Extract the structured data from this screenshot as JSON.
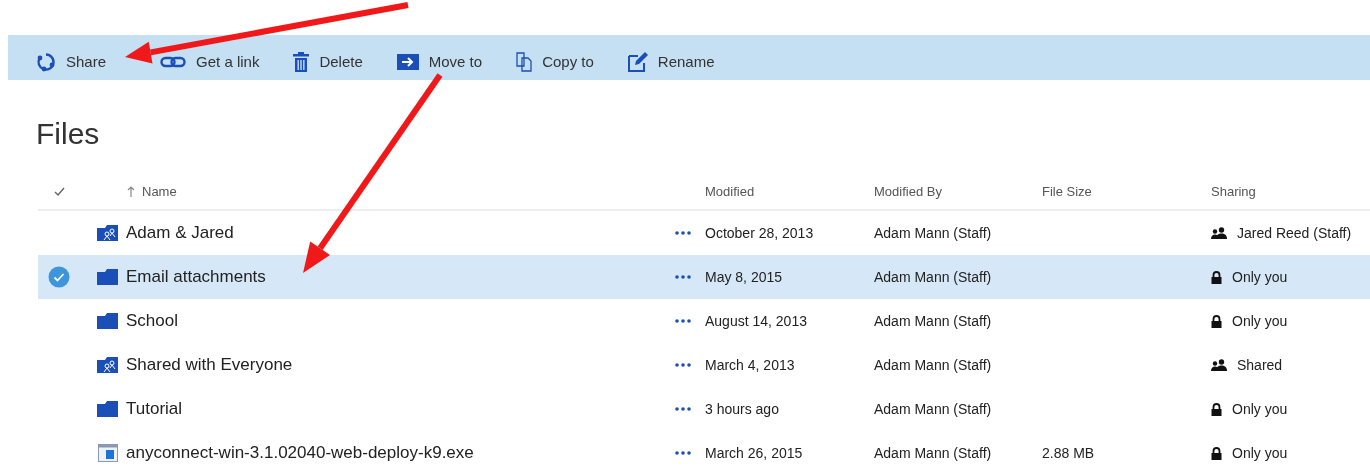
{
  "toolbar": [
    {
      "kind": "share",
      "label": "Share"
    },
    {
      "kind": "link",
      "label": "Get a link"
    },
    {
      "kind": "delete",
      "label": "Delete"
    },
    {
      "kind": "move",
      "label": "Move to"
    },
    {
      "kind": "copy",
      "label": "Copy to"
    },
    {
      "kind": "rename",
      "label": "Rename"
    }
  ],
  "title": "Files",
  "table": {
    "columns": [
      "Name",
      "Modified",
      "Modified By",
      "File Size",
      "Sharing"
    ],
    "rows": [
      {
        "kind": "shared-folder",
        "name": "Adam & Jared",
        "selected": false,
        "modified": "October 28, 2013",
        "modified_by": "Adam Mann (Staff)",
        "sharing": {
          "kind": "people",
          "label": "Jared Reed (Staff)"
        }
      },
      {
        "kind": "folder",
        "name": "Email attachments",
        "selected": true,
        "modified": "May 8, 2015",
        "modified_by": "Adam Mann (Staff)",
        "sharing": {
          "kind": "lock",
          "label": "Only you"
        }
      },
      {
        "kind": "folder",
        "name": "School",
        "selected": false,
        "modified": "August 14, 2013",
        "modified_by": "Adam Mann (Staff)",
        "sharing": {
          "kind": "lock",
          "label": "Only you"
        }
      },
      {
        "kind": "shared-folder",
        "name": "Shared with Everyone",
        "selected": false,
        "modified": "March 4, 2013",
        "modified_by": "Adam Mann (Staff)",
        "sharing": {
          "kind": "people",
          "label": "Shared"
        }
      },
      {
        "kind": "folder",
        "name": "Tutorial",
        "selected": false,
        "modified": "3 hours ago",
        "modified_by": "Adam Mann (Staff)",
        "sharing": {
          "kind": "lock",
          "label": "Only you"
        }
      },
      {
        "kind": "file",
        "name": "anyconnect-win-3.1.02040-web-deploy-k9.exe",
        "selected": false,
        "modified": "March 26, 2015",
        "modified_by": "Adam Mann (Staff)",
        "file_size": "2.88 MB",
        "sharing": {
          "kind": "lock",
          "label": "Only you"
        }
      }
    ]
  }
}
